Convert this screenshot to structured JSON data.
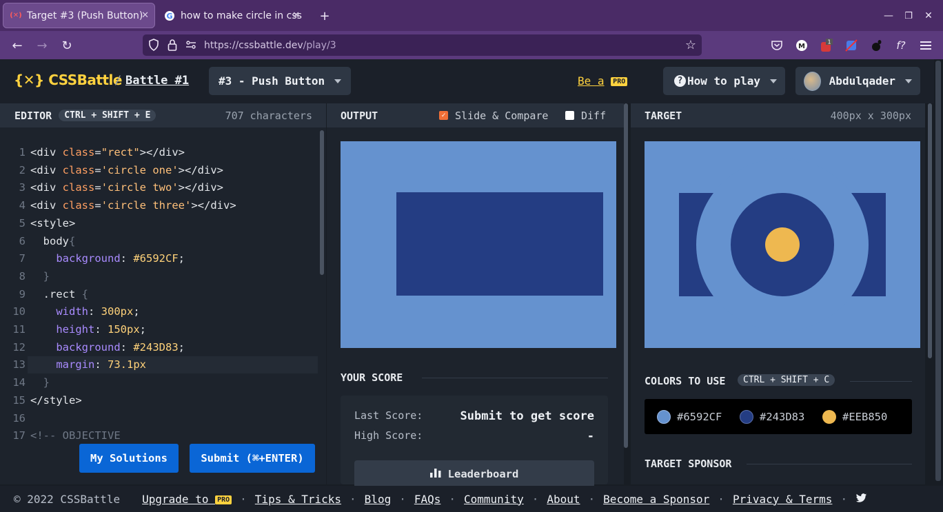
{
  "browser": {
    "tabs": [
      {
        "title": "Target #3 (Push Button)",
        "active": true
      },
      {
        "title": "how to make circle in css",
        "active": false
      }
    ],
    "new_tab": "+",
    "url_host": "https://cssbattle.dev",
    "url_path": "/play/3",
    "window_controls": [
      "minimize",
      "restore",
      "close"
    ]
  },
  "header": {
    "logo": "{✕} CSSBattle",
    "separator": "/",
    "battle": "Battle #1",
    "target_select": "#3 - Push Button",
    "be_a": "Be a",
    "pro": "PRO",
    "how_to_play": "How to play",
    "user": "Abdulqader"
  },
  "editor": {
    "title": "EDITOR",
    "shortcut": "CTRL + SHIFT + E",
    "chars": "707 characters",
    "lines": [
      {
        "n": "1",
        "html": [
          [
            "t",
            "<div "
          ],
          [
            "a",
            "class"
          ],
          [
            "t",
            "="
          ],
          [
            "s",
            "\"rect\""
          ],
          [
            "t",
            "></div>"
          ]
        ]
      },
      {
        "n": "2",
        "html": [
          [
            "t",
            "<div "
          ],
          [
            "a",
            "class"
          ],
          [
            "t",
            "="
          ],
          [
            "s",
            "'circle one'"
          ],
          [
            "t",
            "></div>"
          ]
        ]
      },
      {
        "n": "3",
        "html": [
          [
            "t",
            "<div "
          ],
          [
            "a",
            "class"
          ],
          [
            "t",
            "="
          ],
          [
            "s",
            "'circle two'"
          ],
          [
            "t",
            "></div>"
          ]
        ]
      },
      {
        "n": "4",
        "html": [
          [
            "t",
            "<div "
          ],
          [
            "a",
            "class"
          ],
          [
            "t",
            "="
          ],
          [
            "s",
            "'circle three'"
          ],
          [
            "t",
            "></div>"
          ]
        ]
      },
      {
        "n": "5",
        "html": [
          [
            "t",
            "<style>"
          ]
        ]
      },
      {
        "n": "6",
        "html": [
          [
            "t",
            "  body"
          ],
          [
            "c",
            "{"
          ]
        ]
      },
      {
        "n": "7",
        "html": [
          [
            "t",
            "    "
          ],
          [
            "p",
            "background"
          ],
          [
            "t",
            ": "
          ],
          [
            "v",
            "#6592CF"
          ],
          [
            "t",
            ";"
          ]
        ]
      },
      {
        "n": "8",
        "html": [
          [
            "c",
            "  }"
          ]
        ]
      },
      {
        "n": "9",
        "html": [
          [
            "t",
            "  .rect "
          ],
          [
            "c",
            "{"
          ]
        ]
      },
      {
        "n": "10",
        "html": [
          [
            "t",
            "    "
          ],
          [
            "p",
            "width"
          ],
          [
            "t",
            ": "
          ],
          [
            "v",
            "300px"
          ],
          [
            "t",
            ";"
          ]
        ]
      },
      {
        "n": "11",
        "html": [
          [
            "t",
            "    "
          ],
          [
            "p",
            "height"
          ],
          [
            "t",
            ": "
          ],
          [
            "v",
            "150px"
          ],
          [
            "t",
            ";"
          ]
        ]
      },
      {
        "n": "12",
        "html": [
          [
            "t",
            "    "
          ],
          [
            "p",
            "background"
          ],
          [
            "t",
            ": "
          ],
          [
            "v",
            "#243D83"
          ],
          [
            "t",
            ";"
          ]
        ]
      },
      {
        "n": "13",
        "html": [
          [
            "t",
            "    "
          ],
          [
            "p",
            "margin"
          ],
          [
            "t",
            ": "
          ],
          [
            "v",
            "73.1px"
          ]
        ]
      },
      {
        "n": "14",
        "html": [
          [
            "c",
            "  }"
          ]
        ]
      },
      {
        "n": "15",
        "html": [
          [
            "t",
            "</style>"
          ]
        ]
      },
      {
        "n": "16",
        "html": [
          [
            "t",
            ""
          ]
        ]
      },
      {
        "n": "17",
        "html": [
          [
            "c",
            "<!-- OBJECTIVE"
          ]
        ]
      }
    ],
    "my_solutions": "My Solutions",
    "submit": "Submit (⌘+ENTER)"
  },
  "output": {
    "title": "OUTPUT",
    "slide_compare": "Slide & Compare",
    "slide_compare_checked": true,
    "diff": "Diff",
    "diff_checked": false,
    "score_title": "YOUR SCORE",
    "last_score_label": "Last Score:",
    "last_score_value": "Submit to get score",
    "high_score_label": "High Score:",
    "high_score_value": "-",
    "leaderboard": "Leaderboard"
  },
  "target": {
    "title": "TARGET",
    "size": "400px x 300px",
    "colors_title": "COLORS TO USE",
    "colors_shortcut": "CTRL + SHIFT + C",
    "colors": [
      {
        "hex": "#6592CF"
      },
      {
        "hex": "#243D83"
      },
      {
        "hex": "#EEB850"
      }
    ],
    "sponsor_title": "TARGET SPONSOR"
  },
  "footer": {
    "copyright": "© 2022 CSSBattle",
    "upgrade": "Upgrade to",
    "pro": "PRO",
    "links": [
      "Tips & Tricks",
      "Blog",
      "FAQs",
      "Community",
      "About",
      "Become a Sponsor",
      "Privacy & Terms"
    ]
  }
}
